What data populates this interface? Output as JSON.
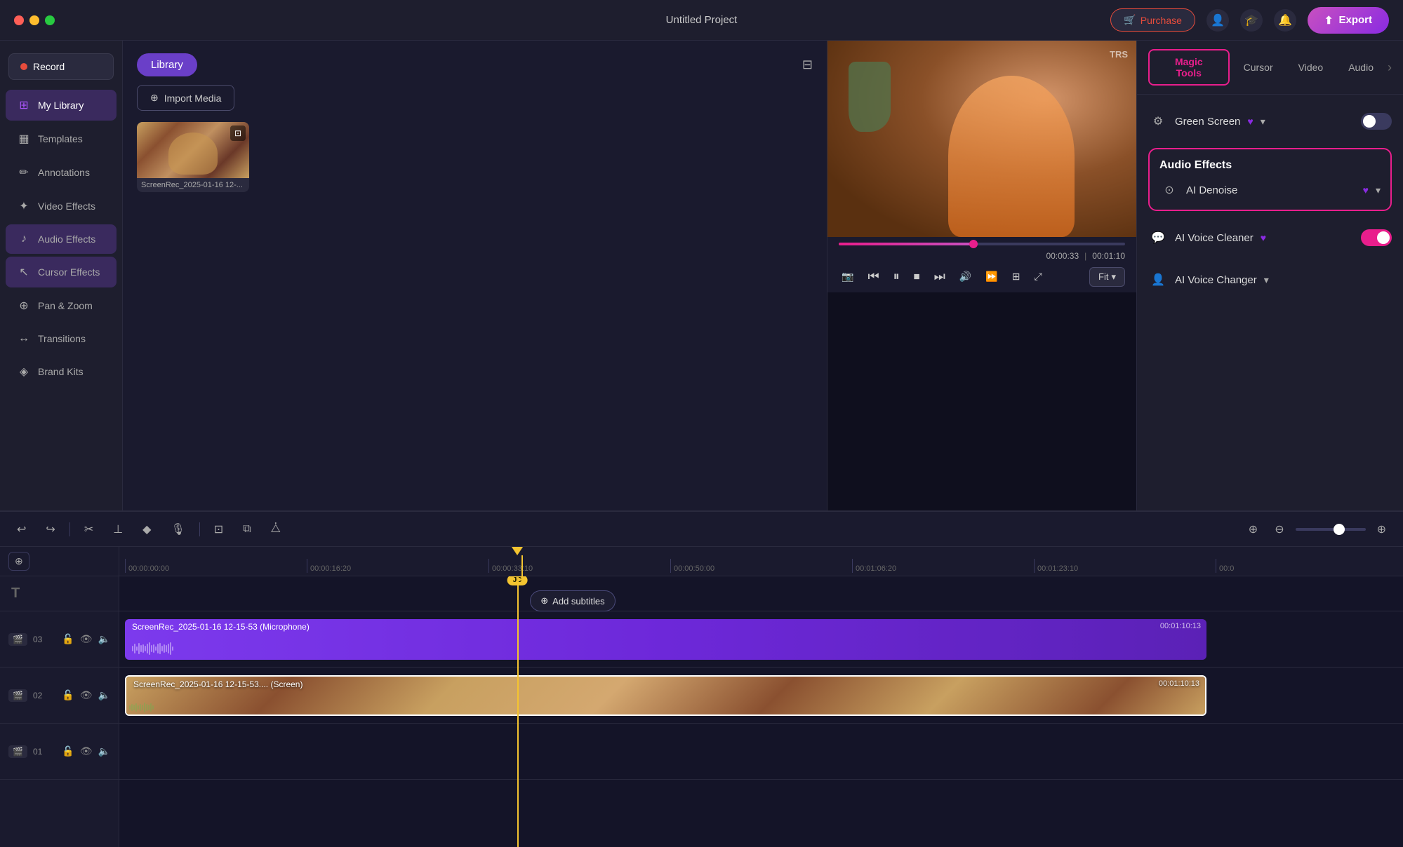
{
  "app": {
    "title": "Untitled Project",
    "window_controls": {
      "close": "●",
      "minimize": "●",
      "maximize": "●"
    }
  },
  "header": {
    "purchase_label": "Purchase",
    "export_label": "Export"
  },
  "sidebar": {
    "record_label": "Record",
    "items": [
      {
        "id": "my-library",
        "label": "My Library",
        "icon": "⊞",
        "active": true
      },
      {
        "id": "templates",
        "label": "Templates",
        "icon": "▦"
      },
      {
        "id": "annotations",
        "label": "Annotations",
        "icon": "✏"
      },
      {
        "id": "video-effects",
        "label": "Video Effects",
        "icon": "✦"
      },
      {
        "id": "audio-effects",
        "label": "Audio Effects",
        "icon": "♪"
      },
      {
        "id": "cursor-effects",
        "label": "Cursor Effects",
        "icon": "↖"
      },
      {
        "id": "pan-zoom",
        "label": "Pan & Zoom",
        "icon": "⊕"
      },
      {
        "id": "transitions",
        "label": "Transitions",
        "icon": "↔"
      },
      {
        "id": "brand-kits",
        "label": "Brand Kits",
        "icon": "◈"
      }
    ]
  },
  "library": {
    "tab_label": "Library",
    "import_label": "Import Media",
    "media_items": [
      {
        "name": "ScreenRec_2025-01-16 12-...",
        "type": "video"
      }
    ]
  },
  "preview": {
    "watermark": "TRS",
    "current_time": "00:00:33",
    "total_time": "00:01:10",
    "fit_label": "Fit"
  },
  "right_panel": {
    "tabs": [
      {
        "id": "magic-tools",
        "label": "Magic Tools",
        "active": true
      },
      {
        "id": "cursor",
        "label": "Cursor"
      },
      {
        "id": "video",
        "label": "Video"
      },
      {
        "id": "audio",
        "label": "Audio"
      }
    ],
    "green_screen": {
      "label": "Green Screen",
      "has_heart": true
    },
    "audio_effects": {
      "title": "Audio Effects",
      "ai_denoise": {
        "label": "AI Denoise",
        "has_heart": true
      },
      "ai_voice_cleaner": {
        "label": "AI Voice Cleaner",
        "has_heart": true
      },
      "ai_voice_changer": {
        "label": "AI Voice Changer"
      }
    }
  },
  "timeline": {
    "toolbar": {
      "undo": "↩",
      "redo": "↪",
      "cut": "✂",
      "split": "⊥",
      "marker": "◆",
      "mic": "🎤",
      "clip_tools": "⊡",
      "multi_edit": "⧉",
      "ripple": "⧊"
    },
    "add_subtitles": "Add subtitles",
    "tracks": [
      {
        "num": "03",
        "type": "audio",
        "label": "ScreenRec_2025-01-16 12-15-53 (Microphone)",
        "time": "00:01:10:13"
      },
      {
        "num": "02",
        "type": "video",
        "label": "ScreenRec_2025-01-16 12-15-53.... (Screen)",
        "time": "00:01:10:13"
      },
      {
        "num": "01",
        "type": "empty"
      }
    ],
    "ruler_marks": [
      "00:00:00:00",
      "00:00:16:20",
      "00:00:33:10",
      "00:00:50:00",
      "00:01:06:20",
      "00:01:23:10",
      "00:0"
    ]
  }
}
